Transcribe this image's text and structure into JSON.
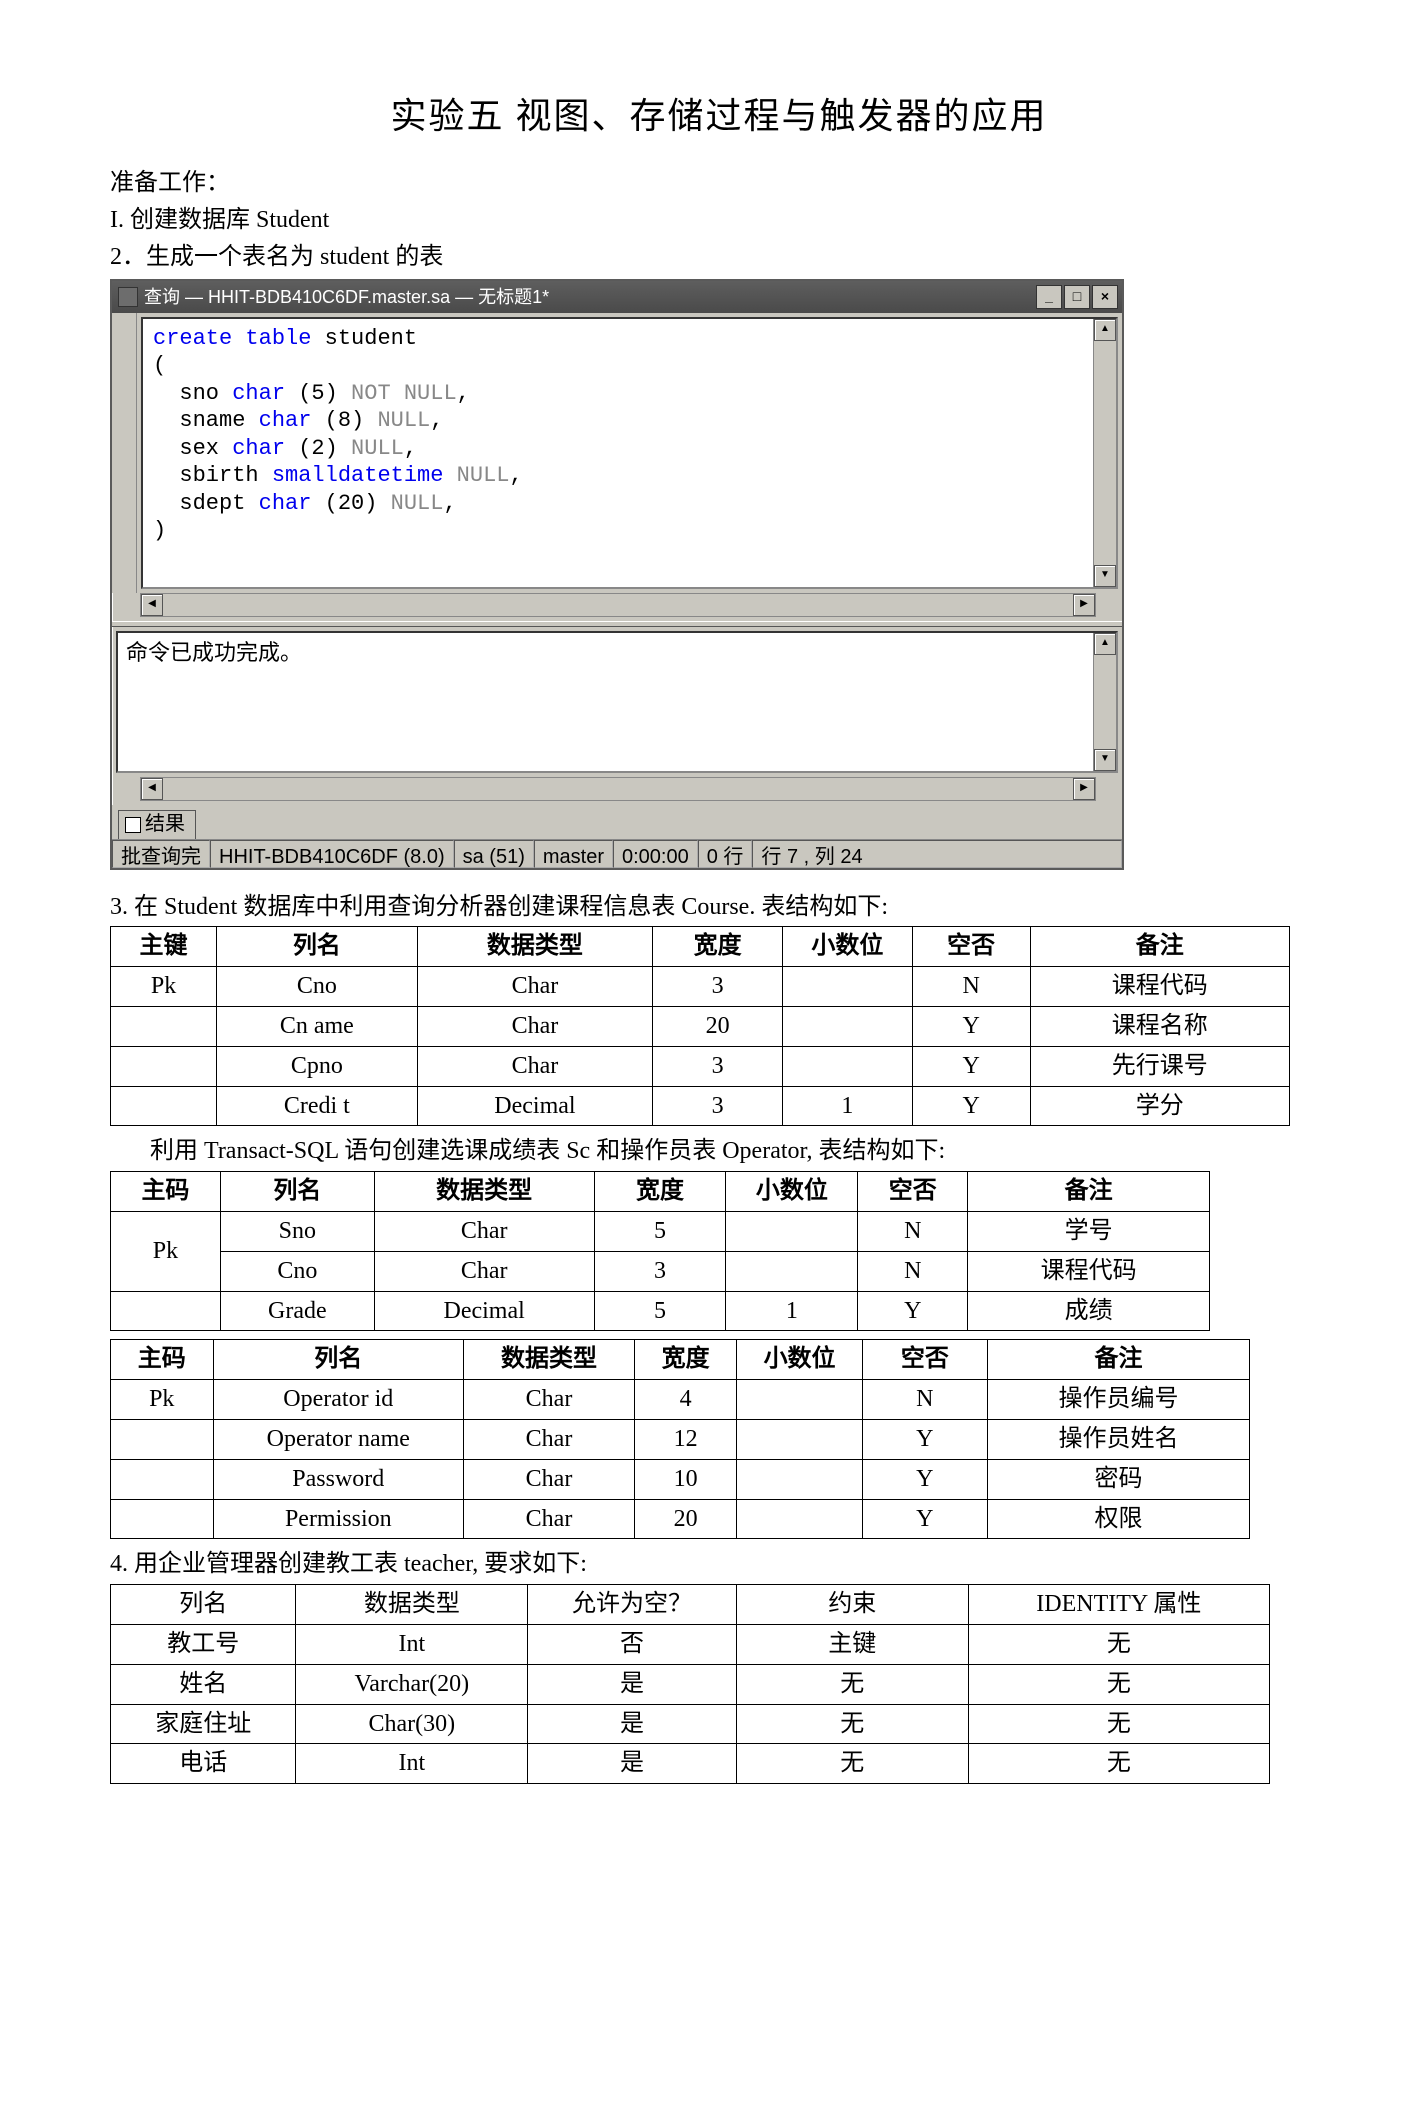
{
  "title": {
    "pre": "实验",
    "bold1": "五",
    "mid": " 视图、",
    "bold2": "存",
    "mid2": "储过",
    "bold3": "程与触",
    "mid3": "发",
    "bold4": "器的",
    "post": "应",
    "bold5": "用"
  },
  "title_plain": "实验五 视图、存储过程与触发器的应用",
  "prep_label": "准备工作：",
  "step1": "I. 创建数据库 Student",
  "step2": "2．生成一个表名为 student 的表",
  "qa": {
    "title": "查询 — HHIT-BDB410C6DF.master.sa — 无标题1*",
    "min": "_",
    "max": "□",
    "close": "×",
    "code": {
      "l1a": "create table",
      "l1b": " student",
      "l2": "(",
      "l3a": "  sno ",
      "l3b": "char",
      "l3c": " (5) ",
      "l3d": "NOT NULL",
      "l3e": ",",
      "l4a": "  sname ",
      "l4b": "char",
      "l4c": " (8) ",
      "l4d": "NULL",
      "l4e": ",",
      "l5a": "  sex ",
      "l5b": "char",
      "l5c": " (2) ",
      "l5d": "NULL",
      "l5e": ",",
      "l6a": "  sbirth ",
      "l6b": "smalldatetime",
      "l6c": " ",
      "l6d": "NULL",
      "l6e": ",",
      "l7a": "  sdept ",
      "l7b": "char",
      "l7c": " (20) ",
      "l7d": "NULL",
      "l7e": ",",
      "l8": ")"
    },
    "result_msg": "命令已成功完成。",
    "tab_label": "结果",
    "status": {
      "s1": "批查询完",
      "s2": "HHIT-BDB410C6DF (8.0)",
      "s3": "sa (51)",
      "s4": "master",
      "s5": "0:00:00",
      "s6": "0 行",
      "s7": "行 7 , 列 24"
    }
  },
  "step3": "3. 在 Student 数据库中利用查询分析器创建课程信息表 Course. 表结构如下:",
  "table1": {
    "headers": [
      "主键",
      "列名",
      "数据类型",
      "宽度",
      "小数位",
      "空否",
      "备注"
    ],
    "rows": [
      [
        "Pk",
        "Cno",
        "Char",
        "3",
        "",
        "N",
        "课程代码"
      ],
      [
        "",
        "Cn ame",
        "Char",
        "20",
        "",
        "Y",
        "课程名称"
      ],
      [
        "",
        "Cpno",
        "Char",
        "3",
        "",
        "Y",
        "先行课号"
      ],
      [
        "",
        "Credi t",
        "Decimal",
        "3",
        "1",
        "Y",
        "学分"
      ]
    ]
  },
  "note2": "利用 Transact-SQL 语句创建选课成绩表 Sc 和操作员表 Operator, 表结构如下:",
  "table2": {
    "headers": [
      "主码",
      "列名",
      "数据类型",
      "宽度",
      "小数位",
      "空否",
      "备注"
    ],
    "pk_label": "Pk",
    "rows": [
      [
        "Sno",
        "Char",
        "5",
        "",
        "N",
        "学号"
      ],
      [
        "Cno",
        "Char",
        "3",
        "",
        "N",
        "课程代码"
      ],
      [
        "Grade",
        "Decimal",
        "5",
        "1",
        "Y",
        "成绩"
      ]
    ]
  },
  "table3": {
    "headers": [
      "主码",
      "列名",
      "数据类型",
      "宽度",
      "小数位",
      "空否",
      "备注"
    ],
    "rows": [
      [
        "Pk",
        "Operator id",
        "Char",
        "4",
        "",
        "N",
        "操作员编号"
      ],
      [
        "",
        "Operator name",
        "Char",
        "12",
        "",
        "Y",
        "操作员姓名"
      ],
      [
        "",
        "Password",
        "Char",
        "10",
        "",
        "Y",
        "密码"
      ],
      [
        "",
        "Permission",
        "Char",
        "20",
        "",
        "Y",
        "权限"
      ]
    ]
  },
  "step4": "4. 用企业管理器创建教工表 teacher, 要求如下:",
  "table4": {
    "headers": [
      "列名",
      "数据类型",
      "允许为空？",
      "约束",
      "IDENTITY 属性"
    ],
    "rows": [
      [
        "教工号",
        "Int",
        "否",
        "主键",
        "无"
      ],
      [
        "姓名",
        "Varchar(20)",
        "是",
        "无",
        "无"
      ],
      [
        "家庭住址",
        "Char(30)",
        "是",
        "无",
        "无"
      ],
      [
        "电话",
        "Int",
        "是",
        "无",
        "无"
      ]
    ]
  }
}
